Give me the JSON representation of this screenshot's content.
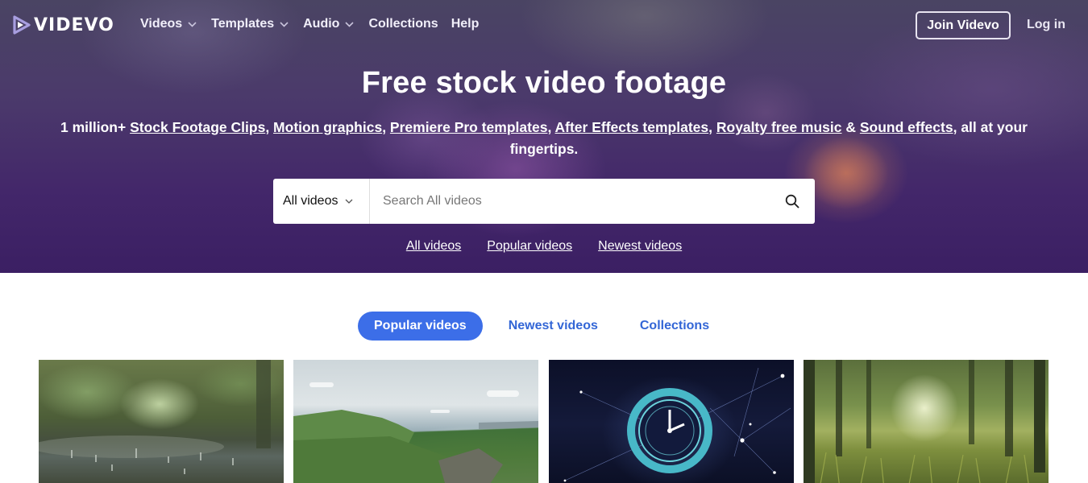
{
  "brand": {
    "name": "VIDEVO"
  },
  "nav": {
    "items": [
      {
        "label": "Videos",
        "has_dropdown": true
      },
      {
        "label": "Templates",
        "has_dropdown": true
      },
      {
        "label": "Audio",
        "has_dropdown": true
      },
      {
        "label": "Collections",
        "has_dropdown": false
      },
      {
        "label": "Help",
        "has_dropdown": false
      }
    ],
    "join_label": "Join Videvo",
    "login_label": "Log in"
  },
  "hero": {
    "title": "Free stock video footage",
    "subtitle": {
      "prefix": "1 million+ ",
      "links": [
        "Stock Footage Clips",
        "Motion graphics",
        "Premiere Pro templates",
        "After Effects templates",
        "Royalty free music",
        "Sound effects"
      ],
      "sep": ", ",
      "amp": " & ",
      "suffix": ", all at your fingertips."
    },
    "search": {
      "category": "All videos",
      "placeholder": "Search All videos"
    },
    "quick_links": [
      "All videos",
      "Popular videos",
      "Newest videos"
    ]
  },
  "tabs": [
    {
      "label": "Popular videos",
      "active": true
    },
    {
      "label": "Newest videos",
      "active": false
    },
    {
      "label": "Collections",
      "active": false
    }
  ],
  "colors": {
    "accent": "#3c6ee8",
    "tab_text": "#3366d6",
    "hero_bg": "#43276a"
  },
  "icons": {
    "logo": "play-triangle-icon",
    "search": "search-icon",
    "dropdown": "chevron-down-icon"
  }
}
